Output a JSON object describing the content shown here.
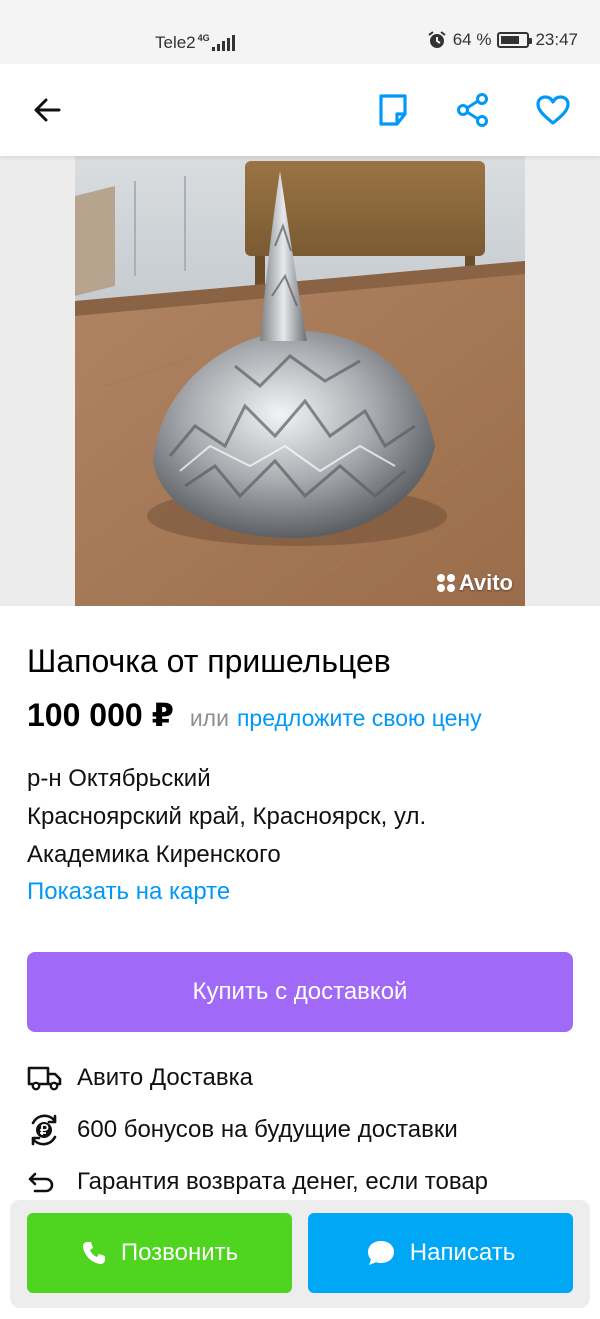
{
  "status_bar": {
    "carrier": "Tele2",
    "network": "4G",
    "battery": "64 %",
    "time": "23:47"
  },
  "header": {
    "back_icon": "arrow-left-icon",
    "note_icon": "note-icon",
    "share_icon": "share-icon",
    "favorite_icon": "heart-icon"
  },
  "photo": {
    "description_icon": "photo-tinfoil-hat",
    "watermark": "Avito"
  },
  "listing": {
    "title": "Шапочка от пришельцев",
    "price": "100 000 ₽",
    "or_text": "или",
    "offer_link": "предложите свою цену",
    "address_line1": "р-н Октябрьский",
    "address_line2": "Красноярский край, Красноярск, ул.",
    "address_line3": "Академика Киренского",
    "map_link": "Показать на карте"
  },
  "buy_button": "Купить с доставкой",
  "features": [
    {
      "icon": "truck-icon",
      "label": "Авито Доставка"
    },
    {
      "icon": "ruble-bonus-icon",
      "label": "600 бонусов на будущие доставки"
    },
    {
      "icon": "return-arrow-icon",
      "label": "Гарантия возврата денег, если товар"
    }
  ],
  "bottom_bar": {
    "call_label": "Позвонить",
    "message_label": "Написать"
  },
  "colors": {
    "accent_blue": "#0099f7",
    "buy_purple": "#a169f7",
    "call_green": "#4fd41f",
    "message_blue": "#00a7f5"
  }
}
